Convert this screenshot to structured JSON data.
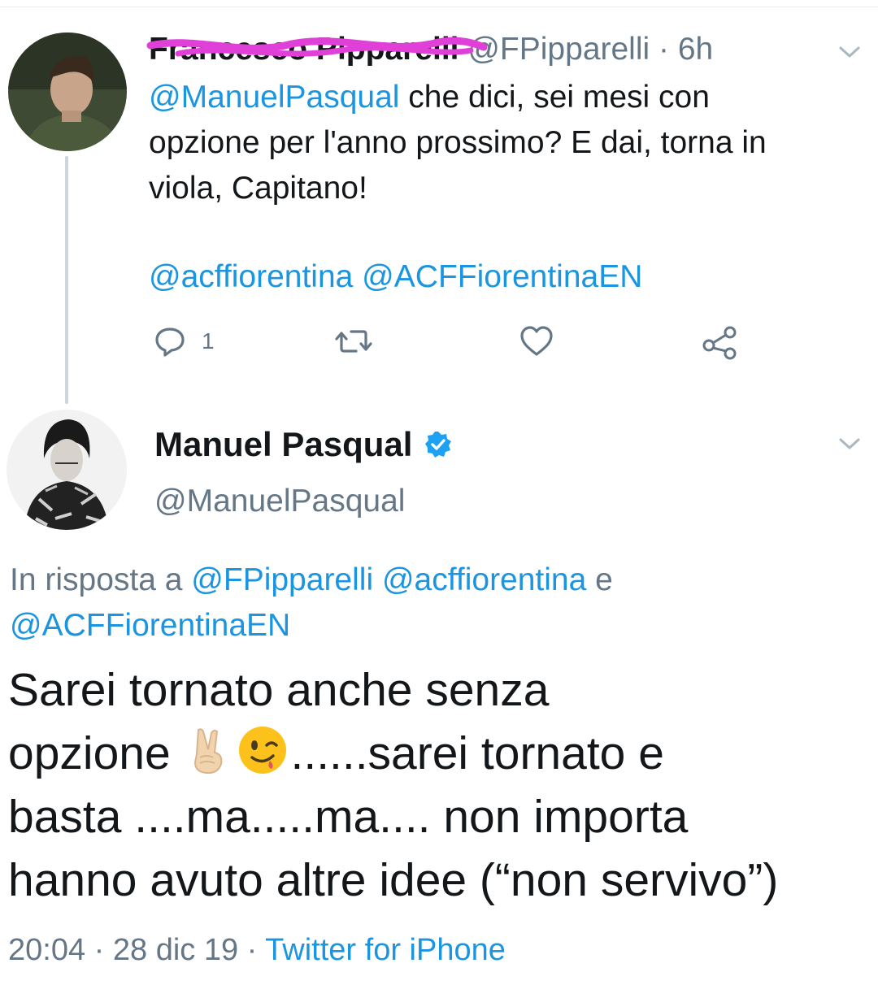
{
  "reply_tweet": {
    "author_name": "Francesco Pipparelli",
    "handle": "@FPipparelli",
    "separator": " · ",
    "time": "6h",
    "body": {
      "mention": "@ManuelPasqual",
      "line1_rest": " che dici, sei mesi con",
      "line2": "opzione per l'anno prossimo? E dai, torna in",
      "line3": "viola, Capitano!"
    },
    "tags": "@acffiorentina @ACFFiorentinaEN",
    "actions": {
      "reply_count": "1",
      "icons": [
        "reply-icon",
        "retweet-icon",
        "like-icon",
        "share-icon"
      ]
    }
  },
  "main_tweet": {
    "author_name": "Manuel Pasqual",
    "verified": true,
    "handle": "@ManuelPasqual",
    "reply_to": {
      "prefix": "In risposta a ",
      "mention1": "@FPipparelli",
      "mention2": "@acffiorentina",
      "conj": " e",
      "mention3": "@ACFFiorentinaEN"
    },
    "text": {
      "line1": "Sarei tornato anche senza",
      "line2_a": "opzione",
      "line2_b": "......sarei tornato e",
      "line3": "basta ....ma.....ma.... non importa",
      "line4": "hanno avuto altre idee (“non servivo”)"
    },
    "emojis": [
      "victory-hand",
      "winking-face"
    ],
    "timestamp": "20:04 · 28 dic 19 · ",
    "source": "Twitter for iPhone"
  },
  "colors": {
    "link": "#1b95e0",
    "secondary_text": "#657786",
    "primary_text": "#14171a",
    "scribble": "#e040d8",
    "thread_line": "#ccd6dd"
  }
}
